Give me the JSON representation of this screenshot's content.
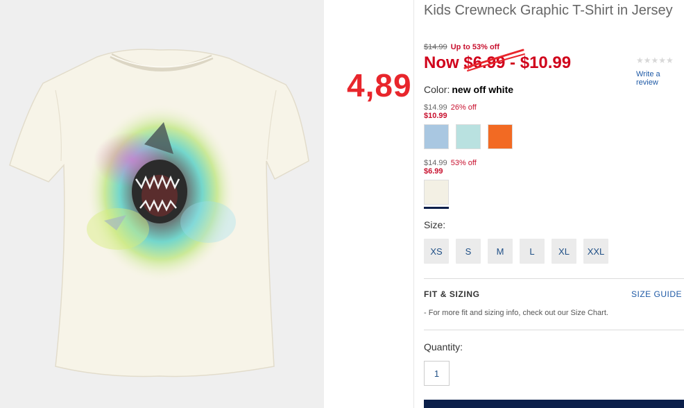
{
  "product": {
    "title": "Kids Crewneck Graphic T-Shirt in Jersey",
    "original_price": "$14.99",
    "discount_text": "Up to 53% off",
    "now_price": "Now $6.99 - $10.99"
  },
  "annotation": {
    "handwritten_price": "4,89"
  },
  "rating": {
    "stars": "★★★★★",
    "write_review": "Write a review"
  },
  "color": {
    "label": "Color:",
    "selected": "new off white"
  },
  "price_groups": [
    {
      "was": "$14.99",
      "pct": "26% off",
      "sale": "$10.99"
    },
    {
      "was": "$14.99",
      "pct": "53% off",
      "sale": "$6.99"
    }
  ],
  "swatches": [
    {
      "name": "light blue",
      "color": "#a9c7e1"
    },
    {
      "name": "light aqua",
      "color": "#b9e1e0"
    },
    {
      "name": "orange",
      "color": "#f26a23"
    },
    {
      "name": "new off white",
      "color": "#f3f0e4",
      "selected": true
    }
  ],
  "sizes": {
    "label": "Size:",
    "options": [
      "XS",
      "S",
      "M",
      "L",
      "XL",
      "XXL"
    ]
  },
  "fit": {
    "title": "FIT & SIZING",
    "size_guide": "SIZE GUIDE",
    "note": "- For more fit and sizing info, check out our Size Chart."
  },
  "quantity": {
    "label": "Quantity:",
    "value": "1"
  },
  "colors": {
    "sale_red": "#d0021b",
    "link_blue": "#1f5aa6",
    "navy": "#0b1f4a"
  }
}
